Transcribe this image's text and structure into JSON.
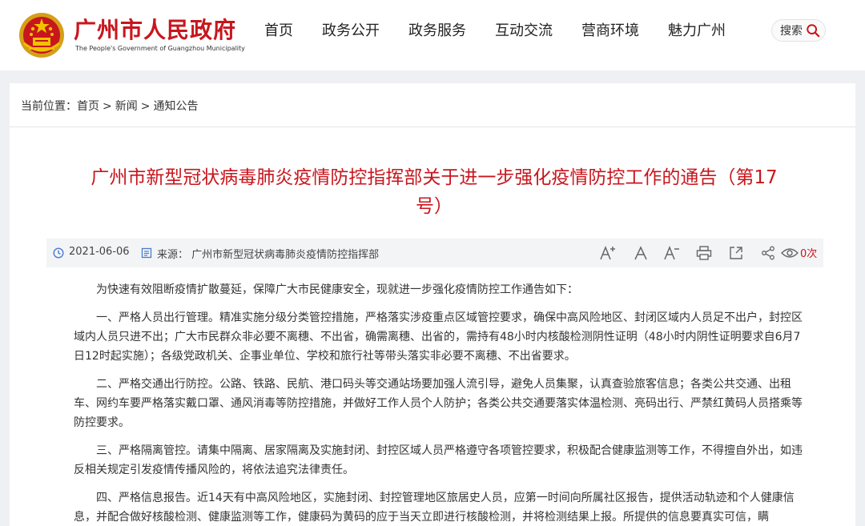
{
  "header": {
    "brand_cn": "广州市人民政府",
    "brand_en": "The People's Government of Guangzhou Municipality",
    "nav": [
      "首页",
      "政务公开",
      "政务服务",
      "互动交流",
      "营商环境",
      "魅力广州"
    ],
    "search_label": "搜索"
  },
  "breadcrumb": {
    "prefix": "当前位置：",
    "items": [
      "首页",
      "新闻",
      "通知公告"
    ],
    "separator": ">"
  },
  "article": {
    "title": "广州市新型冠状病毒肺炎疫情防控指挥部关于进一步强化疫情防控工作的通告（第17号）",
    "date": "2021-06-06",
    "source": "来源： 广州市新型冠状病毒肺炎疫情防控指挥部",
    "view_count": "0次",
    "paragraphs": [
      "为快速有效阻断疫情扩散蔓延，保障广大市民健康安全，现就进一步强化疫情防控工作通告如下：",
      "一、严格人员出行管理。精准实施分级分类管控措施，严格落实涉疫重点区域管控要求，确保中高风险地区、封闭区域内人员足不出户，封控区域内人员只进不出；广大市民群众非必要不离穗、不出省，确需离穗、出省的，需持有48小时内核酸检测阴性证明（48小时内阴性证明要求自6月7日12时起实施）；各级党政机关、企事业单位、学校和旅行社等带头落实非必要不离穗、不出省要求。",
      "二、严格交通出行防控。公路、铁路、民航、港口码头等交通站场要加强人流引导，避免人员集聚，认真查验旅客信息；各类公共交通、出租车、网约车要严格落实戴口罩、通风消毒等防控措施，并做好工作人员个人防护；各类公共交通要落实体温检测、亮码出行、严禁红黄码人员搭乘等防控要求。",
      "三、严格隔离管控。请集中隔离、居家隔离及实施封闭、封控区域人员严格遵守各项管控要求，积极配合健康监测等工作，不得擅自外出，如违反相关规定引发疫情传播风险的，将依法追究法律责任。",
      "四、严格信息报告。近14天有中高风险地区，实施封闭、封控管理地区旅居史人员，应第一时间向所属社区报告，提供活动轨迹和个人健康信息，并配合做好核酸检测、健康监测等工作，健康码为黄码的应于当天立即进行核酸检测，并将检测结果上报。所提供的信息要真实可信，瞒"
    ]
  },
  "colors": {
    "brand_red": "#c8161d",
    "page_bg": "#eef0f4",
    "meta_bg": "#f3f4f6"
  },
  "icons": [
    "national-emblem",
    "search-icon",
    "calendar-icon",
    "document-icon",
    "font-increase-icon",
    "font-normal-icon",
    "font-decrease-icon",
    "print-icon",
    "share-external-icon",
    "share-icon",
    "eye-icon"
  ]
}
